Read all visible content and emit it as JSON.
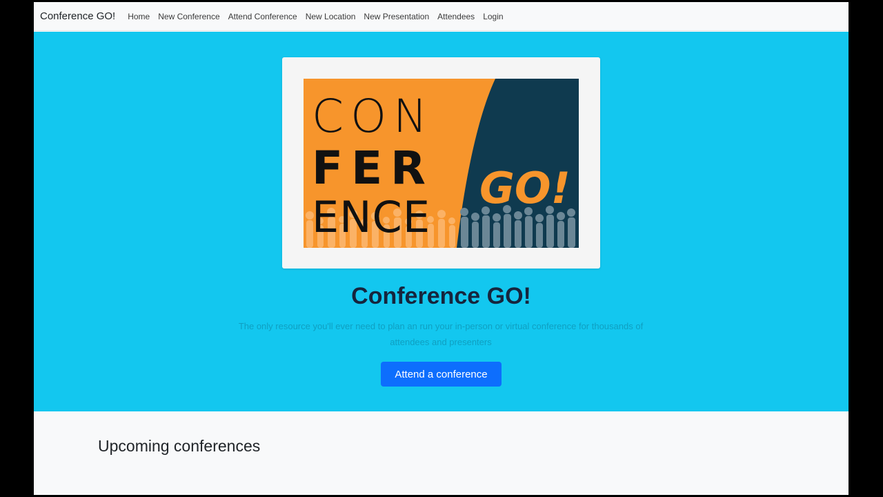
{
  "navbar": {
    "brand": "Conference GO!",
    "links": [
      "Home",
      "New Conference",
      "Attend Conference",
      "New Location",
      "New Presentation",
      "Attendees",
      "Login"
    ]
  },
  "hero": {
    "logo": {
      "line1": "CON",
      "line2": "FER",
      "line3": "ENCE",
      "go": "GO!",
      "colors": {
        "orange": "#f7952c",
        "navy": "#0f3a4f",
        "cyan": "#13c7ef"
      }
    },
    "title": "Conference GO!",
    "lead": "The only resource you'll ever need to plan an run your in-person or virtual conference for thousands of attendees and presenters",
    "cta_label": "Attend a conference"
  },
  "upcoming": {
    "title": "Upcoming conferences"
  }
}
